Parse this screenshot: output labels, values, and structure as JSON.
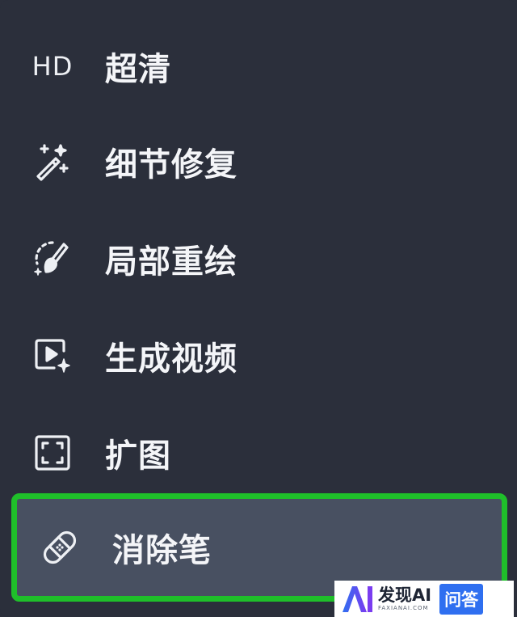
{
  "menu": {
    "items": [
      {
        "label": "超清",
        "icon": "hd-icon",
        "icon_text": "HD"
      },
      {
        "label": "细节修复",
        "icon": "magic-wand-icon"
      },
      {
        "label": "局部重绘",
        "icon": "brush-icon"
      },
      {
        "label": "生成视频",
        "icon": "video-sparkle-icon"
      },
      {
        "label": "扩图",
        "icon": "expand-icon"
      },
      {
        "label": "消除笔",
        "icon": "bandage-icon",
        "selected": true
      }
    ]
  },
  "watermark": {
    "logo_text": "AI",
    "brand": "发现AI",
    "domain": "FAXIANAI.COM",
    "tag": "问答"
  },
  "colors": {
    "background": "#2b2f3b",
    "selected_background": "#485061",
    "highlight_border": "#1fbf2a",
    "text": "#f4f5f8",
    "watermark_accent": "#2f6ff0"
  }
}
